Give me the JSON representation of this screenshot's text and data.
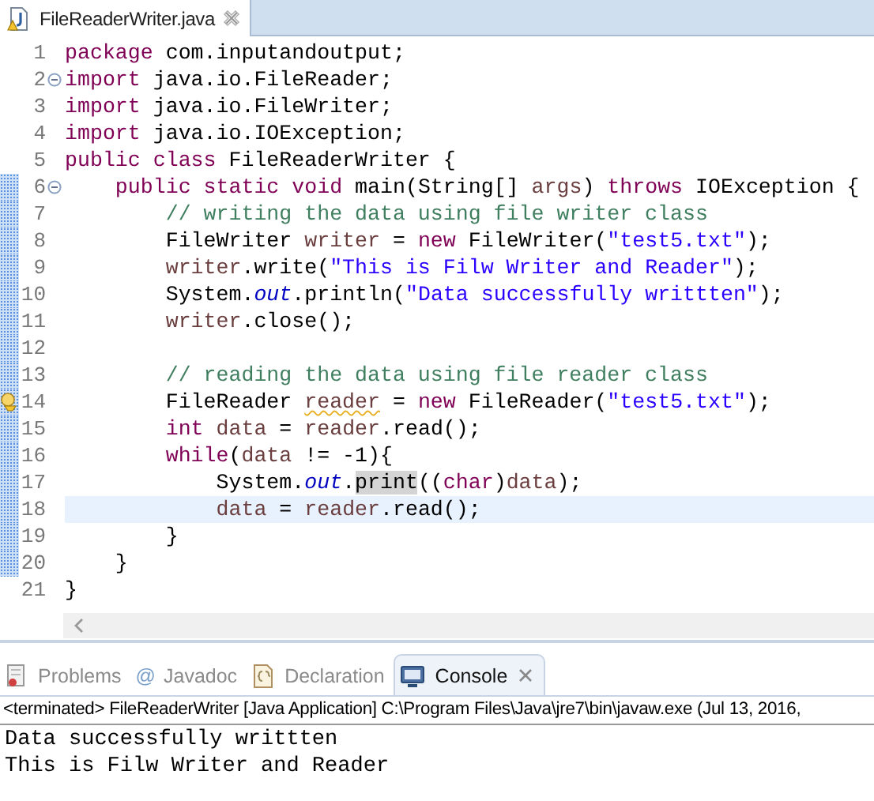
{
  "editor_tab": {
    "title": "FileReaderWriter.java",
    "selected": true,
    "warning": true
  },
  "code_lines": [
    {
      "number": "1",
      "changed": false,
      "foldable": false,
      "warning": false,
      "current": false,
      "tokens": [
        {
          "kind": "keyword",
          "text": "package"
        },
        {
          "kind": "plain",
          "text": " com.inputandoutput;"
        }
      ]
    },
    {
      "number": "2",
      "changed": false,
      "foldable": true,
      "warning": false,
      "current": false,
      "tokens": [
        {
          "kind": "keyword",
          "text": "import"
        },
        {
          "kind": "plain",
          "text": " java.io.FileReader;"
        }
      ]
    },
    {
      "number": "3",
      "changed": false,
      "foldable": false,
      "warning": false,
      "current": false,
      "tokens": [
        {
          "kind": "keyword",
          "text": "import"
        },
        {
          "kind": "plain",
          "text": " java.io.FileWriter;"
        }
      ]
    },
    {
      "number": "4",
      "changed": false,
      "foldable": false,
      "warning": false,
      "current": false,
      "tokens": [
        {
          "kind": "keyword",
          "text": "import"
        },
        {
          "kind": "plain",
          "text": " java.io.IOException;"
        }
      ]
    },
    {
      "number": "5",
      "changed": false,
      "foldable": false,
      "warning": false,
      "current": false,
      "tokens": [
        {
          "kind": "keyword",
          "text": "public class"
        },
        {
          "kind": "plain",
          "text": " FileReaderWriter {"
        }
      ]
    },
    {
      "number": "6",
      "changed": true,
      "foldable": true,
      "warning": false,
      "current": false,
      "tokens": [
        {
          "kind": "keyword",
          "text": "    public static void"
        },
        {
          "kind": "plain",
          "text": " main(String[] "
        },
        {
          "kind": "variable",
          "text": "args"
        },
        {
          "kind": "plain",
          "text": ") "
        },
        {
          "kind": "keyword",
          "text": "throws"
        },
        {
          "kind": "plain",
          "text": " IOException {"
        }
      ]
    },
    {
      "number": "7",
      "changed": true,
      "foldable": false,
      "warning": false,
      "current": false,
      "tokens": [
        {
          "kind": "comment",
          "text": "        // writing the data using file writer class"
        }
      ]
    },
    {
      "number": "8",
      "changed": true,
      "foldable": false,
      "warning": false,
      "current": false,
      "tokens": [
        {
          "kind": "plain",
          "text": "        FileWriter "
        },
        {
          "kind": "variable",
          "text": "writer"
        },
        {
          "kind": "plain",
          "text": " = "
        },
        {
          "kind": "keyword",
          "text": "new"
        },
        {
          "kind": "plain",
          "text": " FileWriter("
        },
        {
          "kind": "string",
          "text": "\"test5.txt\""
        },
        {
          "kind": "plain",
          "text": ");"
        }
      ]
    },
    {
      "number": "9",
      "changed": true,
      "foldable": false,
      "warning": false,
      "current": false,
      "tokens": [
        {
          "kind": "variable",
          "text": "        writer"
        },
        {
          "kind": "plain",
          "text": ".write("
        },
        {
          "kind": "string",
          "text": "\"This is Filw Writer and Reader\""
        },
        {
          "kind": "plain",
          "text": ");"
        }
      ]
    },
    {
      "number": "10",
      "changed": true,
      "foldable": false,
      "warning": false,
      "current": false,
      "tokens": [
        {
          "kind": "plain",
          "text": "        System."
        },
        {
          "kind": "field",
          "text": "out"
        },
        {
          "kind": "plain",
          "text": ".println("
        },
        {
          "kind": "string",
          "text": "\"Data successfully writtten\""
        },
        {
          "kind": "plain",
          "text": ");"
        }
      ]
    },
    {
      "number": "11",
      "changed": true,
      "foldable": false,
      "warning": false,
      "current": false,
      "tokens": [
        {
          "kind": "variable",
          "text": "        writer"
        },
        {
          "kind": "plain",
          "text": ".close();"
        }
      ]
    },
    {
      "number": "12",
      "changed": true,
      "foldable": false,
      "warning": false,
      "current": false
    },
    {
      "number": "13",
      "changed": true,
      "foldable": false,
      "warning": false,
      "current": false,
      "tokens": [
        {
          "kind": "comment",
          "text": "        // reading the data using file reader class"
        }
      ]
    },
    {
      "number": "14",
      "changed": true,
      "foldable": false,
      "warning": true,
      "current": false,
      "tokens": [
        {
          "kind": "plain",
          "text": "        FileReader "
        },
        {
          "kind": "warned-variable",
          "text": "reader"
        },
        {
          "kind": "plain",
          "text": " = "
        },
        {
          "kind": "keyword",
          "text": "new"
        },
        {
          "kind": "plain",
          "text": " FileReader("
        },
        {
          "kind": "string",
          "text": "\"test5.txt\""
        },
        {
          "kind": "plain",
          "text": ");"
        }
      ]
    },
    {
      "number": "15",
      "changed": true,
      "foldable": false,
      "warning": false,
      "current": false,
      "tokens": [
        {
          "kind": "keyword",
          "text": "        int"
        },
        {
          "kind": "variable",
          "text": " data"
        },
        {
          "kind": "plain",
          "text": " = "
        },
        {
          "kind": "variable",
          "text": "reader"
        },
        {
          "kind": "plain",
          "text": ".read();"
        }
      ]
    },
    {
      "number": "16",
      "changed": true,
      "foldable": false,
      "warning": false,
      "current": false,
      "tokens": [
        {
          "kind": "keyword",
          "text": "        while"
        },
        {
          "kind": "plain",
          "text": "("
        },
        {
          "kind": "variable",
          "text": "data"
        },
        {
          "kind": "plain",
          "text": " != -1){"
        }
      ]
    },
    {
      "number": "17",
      "changed": true,
      "foldable": false,
      "warning": false,
      "current": false,
      "tokens": [
        {
          "kind": "plain",
          "text": "            System."
        },
        {
          "kind": "field",
          "text": "out"
        },
        {
          "kind": "plain",
          "text": "."
        },
        {
          "kind": "occurrence",
          "text": "print"
        },
        {
          "kind": "plain",
          "text": "(("
        },
        {
          "kind": "keyword",
          "text": "char"
        },
        {
          "kind": "plain",
          "text": ")"
        },
        {
          "kind": "variable",
          "text": "data"
        },
        {
          "kind": "plain",
          "text": ");"
        }
      ]
    },
    {
      "number": "18",
      "changed": true,
      "foldable": false,
      "warning": false,
      "current": true,
      "tokens": [
        {
          "kind": "variable",
          "text": "            data"
        },
        {
          "kind": "plain",
          "text": " = "
        },
        {
          "kind": "variable",
          "text": "reader"
        },
        {
          "kind": "plain",
          "text": ".read();"
        }
      ]
    },
    {
      "number": "19",
      "changed": true,
      "foldable": false,
      "warning": false,
      "current": false,
      "tokens": [
        {
          "kind": "plain",
          "text": "        }"
        }
      ]
    },
    {
      "number": "20",
      "changed": true,
      "foldable": false,
      "warning": false,
      "current": false,
      "tokens": [
        {
          "kind": "plain",
          "text": "    }"
        }
      ]
    },
    {
      "number": "21",
      "changed": false,
      "foldable": false,
      "warning": false,
      "current": false,
      "tokens": [
        {
          "kind": "plain",
          "text": "}"
        }
      ]
    }
  ],
  "panel_tabs": [
    {
      "kind": "problems",
      "label": "Problems",
      "selected": false
    },
    {
      "kind": "javadoc",
      "glyph": "@",
      "label": "Javadoc",
      "selected": false
    },
    {
      "kind": "declaration",
      "label": "Declaration",
      "selected": false
    },
    {
      "kind": "console",
      "label": "Console",
      "selected": true
    }
  ],
  "console": {
    "description": "<terminated> FileReaderWriter [Java Application] C:\\Program Files\\Java\\jre7\\bin\\javaw.exe (Jul 13, 2016,",
    "output": [
      "Data successfully writtten",
      "This is Filw Writer and Reader"
    ]
  }
}
